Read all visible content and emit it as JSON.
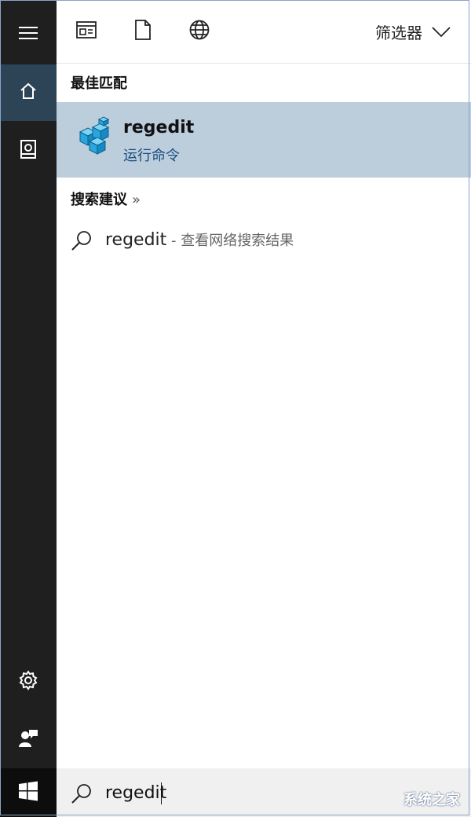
{
  "rail": {
    "items": [
      {
        "icon": "hamburger-menu-icon"
      },
      {
        "icon": "home-icon"
      },
      {
        "icon": "documents-icon"
      },
      {
        "icon": "gear-icon"
      },
      {
        "icon": "user-feedback-icon"
      },
      {
        "icon": "windows-start-icon"
      }
    ]
  },
  "topbar": {
    "icons": [
      "apps-icon",
      "document-icon",
      "web-icon"
    ],
    "filter_label": "筛选器"
  },
  "best_match": {
    "title": "最佳匹配",
    "app_name": "regedit",
    "app_type": "运行命令"
  },
  "suggestions": {
    "title": "搜索建议",
    "arrow": "»",
    "items": [
      {
        "text": "regedit",
        "subtext": " - 查看网络搜索结果"
      }
    ]
  },
  "search": {
    "value": "regedit"
  },
  "watermark": {
    "text": "系统之家"
  },
  "colors": {
    "rail_bg": "#1f1f1f",
    "rail_active": "#2d4457",
    "selected_bg": "#bccddc",
    "link_blue": "#1c4e82"
  }
}
